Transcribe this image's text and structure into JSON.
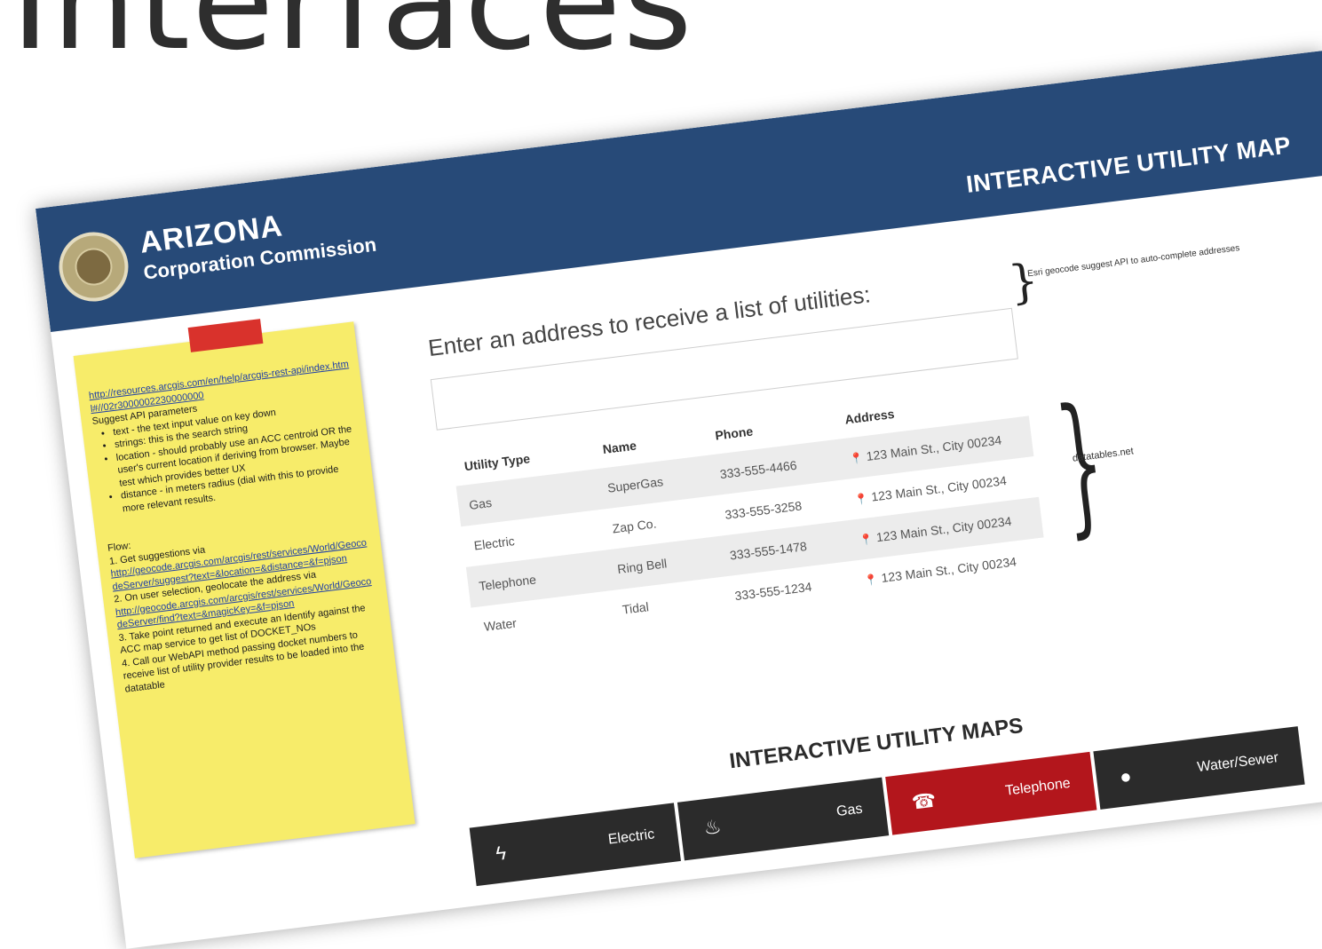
{
  "slide": {
    "headline": "Interfaces"
  },
  "header": {
    "org_name": "ARIZONA",
    "org_subtitle": "Corporation Commission",
    "app_title": "INTERACTIVE UTILITY MAP"
  },
  "note": {
    "link1": "http://resources.arcgis.com/en/help/arcgis-rest-api/index.html#//02r3000002230000000",
    "title": "Suggest API parameters",
    "bullets": [
      "text - the text input value on key down",
      "strings: this is the search string",
      "location - should probably use an ACC centroid OR the user's current location if deriving from browser. Maybe test which provides better UX",
      "distance - in meters radius (dial with this to provide more relevant results."
    ],
    "flow_title": "Flow:",
    "steps": [
      "1. Get suggestions via",
      "http://geocode.arcgis.com/arcgis/rest/services/World/GeocodeServer/suggest?text=&location=&distance=&f=pjson",
      "2. On user selection, geolocate the address via",
      "http://geocode.arcgis.com/arcgis/rest/services/World/GeocodeServer/find?text=&magicKey=&f=pjson",
      "3. Take point returned and execute an Identify against the ACC map service to get list of DOCKET_NOs",
      "4. Call our WebAPI method passing docket numbers to receive list of utility provider results to be loaded into the datatable"
    ]
  },
  "search": {
    "prompt": "Enter an address to receive a list of utilities:",
    "side_note": "Esri geocode suggest API to auto-complete addresses"
  },
  "table": {
    "headers": [
      "Utility Type",
      "Name",
      "Phone",
      "Address"
    ],
    "rows": [
      [
        "Gas",
        "SuperGas",
        "333-555-4466",
        "123 Main St., City 00234"
      ],
      [
        "Electric",
        "Zap Co.",
        "333-555-3258",
        "123 Main St., City 00234"
      ],
      [
        "Telephone",
        "Ring Bell",
        "333-555-1478",
        "123 Main St., City 00234"
      ],
      [
        "Water",
        "Tidal",
        "333-555-1234",
        "123 Main St., City 00234"
      ]
    ],
    "side_note": "datatables.net"
  },
  "maps": {
    "title": "INTERACTIVE UTILITY MAPS",
    "tiles": [
      {
        "label": "Electric",
        "icon": "lightning-icon",
        "glyph": "ϟ",
        "active": false
      },
      {
        "label": "Gas",
        "icon": "flame-icon",
        "glyph": "♨",
        "active": false
      },
      {
        "label": "Telephone",
        "icon": "phone-icon",
        "glyph": "☎",
        "active": true
      },
      {
        "label": "Water/Sewer",
        "icon": "water-drop-icon",
        "glyph": "●",
        "active": false
      }
    ]
  },
  "colors": {
    "header": "#274a78",
    "active_tile": "#b3161c",
    "tile": "#2b2b2b",
    "note": "#f7ec6a"
  }
}
